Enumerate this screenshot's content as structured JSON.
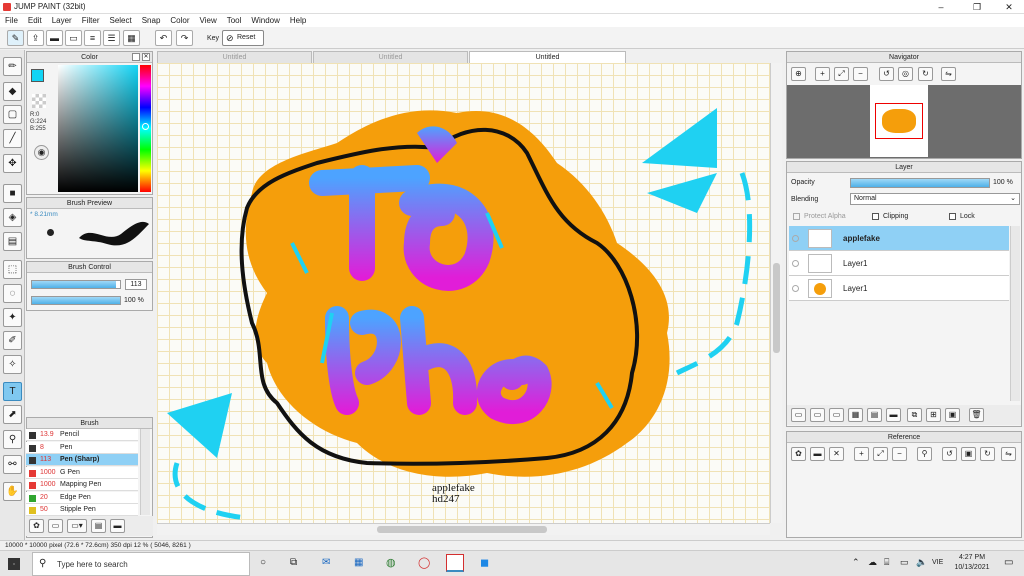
{
  "window": {
    "title": "JUMP PAINT (32bit)",
    "minimize": "–",
    "maximize": "❐",
    "close": "✕"
  },
  "menu": [
    "File",
    "Edit",
    "Layer",
    "Filter",
    "Select",
    "Snap",
    "Color",
    "View",
    "Tool",
    "Window",
    "Help"
  ],
  "toolbar": {
    "key_label": "Key",
    "reset_label": "Reset"
  },
  "tabs": [
    "Untitled",
    "Untitled",
    "Untitled"
  ],
  "color_panel": {
    "title": "Color",
    "r": "R:0",
    "g": "G:224",
    "b": "B:255",
    "fg": "#12d4f5",
    "bg": "#e01fb8"
  },
  "brush_preview": {
    "title": "Brush Preview",
    "size": "8.21mm"
  },
  "brush_control": {
    "title": "Brush Control",
    "size_value": "113",
    "opacity_value": "100 %",
    "size_fill": 0.95,
    "opacity_fill": 1.0
  },
  "brush": {
    "title": "Brush",
    "items": [
      {
        "size": "13.9",
        "name": "Pencil",
        "color": "#333"
      },
      {
        "size": "8",
        "name": "Pen",
        "color": "#333"
      },
      {
        "size": "113",
        "name": "Pen (Sharp)",
        "color": "#333"
      },
      {
        "size": "1000",
        "name": "G Pen",
        "color": "#e53935"
      },
      {
        "size": "1000",
        "name": "Mapping Pen",
        "color": "#e53935"
      },
      {
        "size": "20",
        "name": "Edge Pen",
        "color": "#2fa52f"
      },
      {
        "size": "50",
        "name": "Stipple Pen",
        "color": "#e0c020"
      }
    ],
    "selected": 2
  },
  "canvas": {
    "signature_line1": "applefake",
    "signature_line2": "hd247"
  },
  "navigator": {
    "title": "Navigator"
  },
  "layer_panel": {
    "title": "Layer",
    "opacity_label": "Opacity",
    "opacity_value": "100 %",
    "blending_label": "Blending",
    "blending_value": "Normal",
    "protect_alpha": "Protect Alpha",
    "clipping": "Clipping",
    "lock": "Lock",
    "layers": [
      {
        "name": "applefake",
        "selected": true
      },
      {
        "name": "Layer1",
        "selected": false
      },
      {
        "name": "Layer1",
        "selected": false
      }
    ]
  },
  "reference": {
    "title": "Reference"
  },
  "status": {
    "text": "10000 * 10000 pixel   (72.6 * 72.6cm)   350 dpi   12 %   ( 5046, 8261 )"
  },
  "taskbar": {
    "search_placeholder": "Type here to search",
    "time": "4:27 PM",
    "date": "10/13/2021",
    "lang": "VIE"
  }
}
